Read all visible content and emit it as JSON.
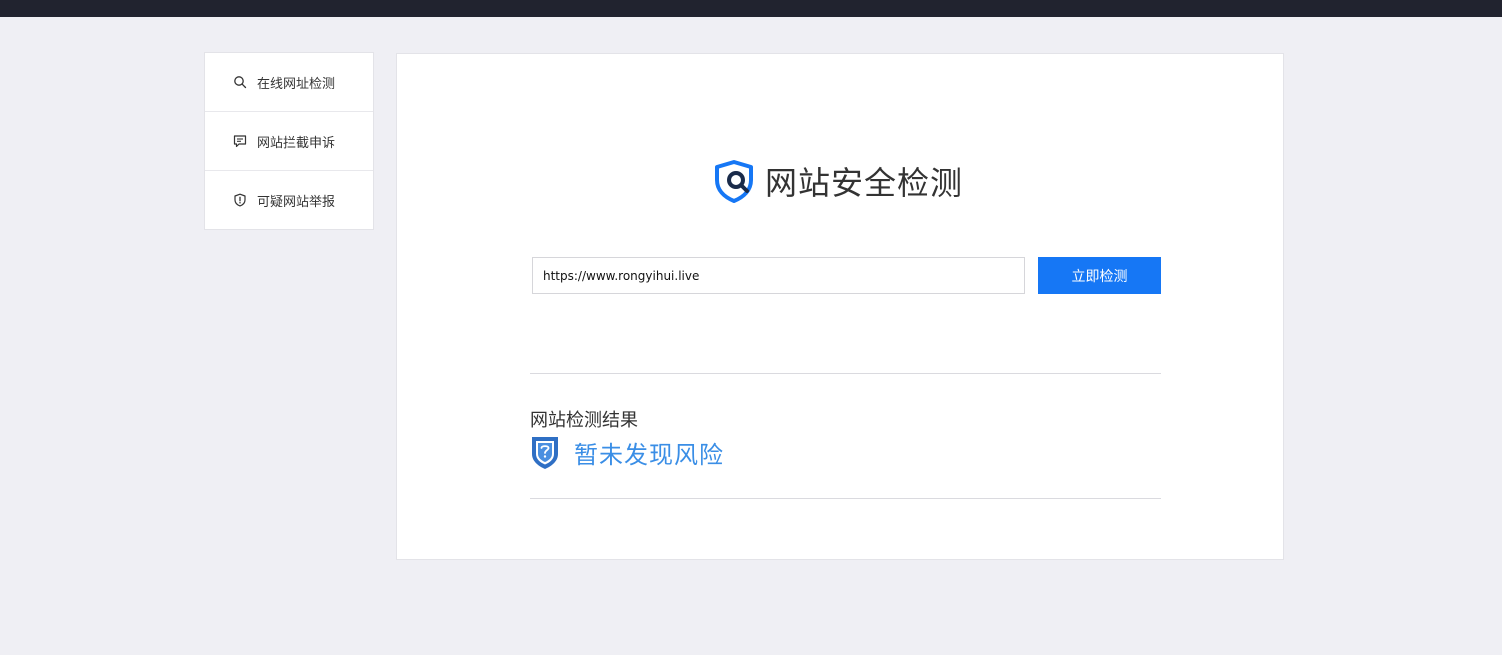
{
  "sidebar": {
    "items": [
      {
        "label": "在线网址检测",
        "icon": "search-icon"
      },
      {
        "label": "网站拦截申诉",
        "icon": "message-icon"
      },
      {
        "label": "可疑网站举报",
        "icon": "shield-alert-icon"
      }
    ]
  },
  "main": {
    "title": "网站安全检测",
    "url_input": {
      "value": "https://www.rongyihui.live"
    },
    "check_button": "立即检测",
    "result_title": "网站检测结果",
    "result_text": "暂未发现风险"
  },
  "colors": {
    "accent": "#1677f5",
    "result": "#3a8ee6",
    "topbar": "#21232f",
    "background": "#efeff4"
  }
}
